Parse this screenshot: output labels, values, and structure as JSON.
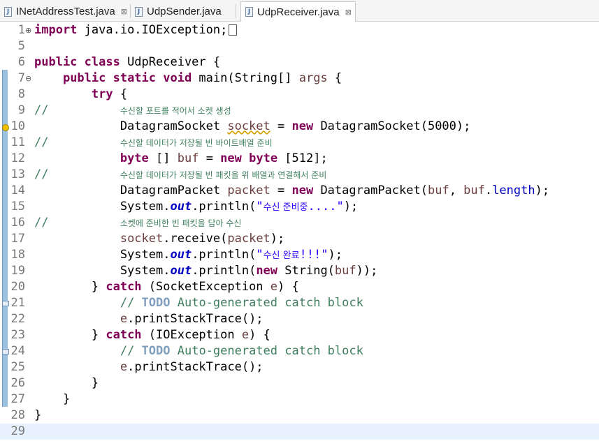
{
  "tabs": [
    {
      "label": "INetAddressTest.java",
      "close": "⊠",
      "icon": "java-file-icon"
    },
    {
      "label": "UdpSender.java",
      "icon": "java-file-icon"
    },
    {
      "label": "UdpReceiver.java",
      "close": "⊠",
      "icon": "java-file-icon"
    }
  ],
  "editor": {
    "lines": [
      {
        "n": "1",
        "marker": "⊕",
        "segs": [
          [
            "kw",
            "import"
          ],
          [
            "",
            "java.io.IOException;"
          ]
        ],
        "fold": true
      },
      {
        "n": "5",
        "segs": []
      },
      {
        "n": "6",
        "segs": [
          [
            "kw",
            "public class"
          ],
          [
            "",
            "UdpReceiver {"
          ]
        ]
      },
      {
        "n": "7",
        "marker": "⊖",
        "segs": [
          [
            "",
            "    "
          ],
          [
            "kw",
            "public static void"
          ],
          [
            "",
            "main(String[]"
          ],
          [
            "var",
            "args"
          ],
          [
            "",
            " {"
          ]
        ]
      },
      {
        "n": "8",
        "segs": [
          [
            "",
            "        "
          ],
          [
            "kw",
            "try"
          ],
          [
            "",
            " {"
          ]
        ]
      },
      {
        "n": "9",
        "segs": [
          [
            "cmt",
            "//          "
          ],
          [
            "kor",
            "수신할 포트를 적어서 소켓 생성"
          ]
        ]
      },
      {
        "n": "10",
        "segs": [
          [
            "",
            "            DatagramSocket "
          ],
          [
            "varw",
            "socket"
          ],
          [
            "",
            " = "
          ],
          [
            "kw",
            "new"
          ],
          [
            "",
            " DatagramSocket(5000);"
          ]
        ]
      },
      {
        "n": "11",
        "segs": [
          [
            "cmt",
            "//          "
          ],
          [
            "kor",
            "수신할 데이터가 저장될 빈 바이트배열 준비"
          ]
        ]
      },
      {
        "n": "12",
        "segs": [
          [
            "",
            "            "
          ],
          [
            "kw",
            "byte"
          ],
          [
            "",
            "[] "
          ],
          [
            "var",
            "buf"
          ],
          [
            "",
            " = "
          ],
          [
            "kw",
            "new byte"
          ],
          [
            "",
            "[512];"
          ]
        ]
      },
      {
        "n": "13",
        "segs": [
          [
            "cmt",
            "//          "
          ],
          [
            "kor",
            "수신할 데이터가 저장될 빈 패킷을 위 배열과 연결해서 준비"
          ]
        ]
      },
      {
        "n": "14",
        "segs": [
          [
            "",
            "            DatagramPacket "
          ],
          [
            "var",
            "packet"
          ],
          [
            "",
            " = "
          ],
          [
            "kw",
            "new"
          ],
          [
            "",
            " DatagramPacket("
          ],
          [
            "var",
            "buf"
          ],
          [
            "",
            ", "
          ],
          [
            "var",
            "buf"
          ],
          [
            "",
            "."
          ],
          [
            "fld",
            "length"
          ],
          [
            "",
            ");"
          ]
        ]
      },
      {
        "n": "15",
        "segs": [
          [
            "",
            "            System."
          ],
          [
            "sfld",
            "out"
          ],
          [
            "",
            ".println("
          ],
          [
            "str",
            "\""
          ],
          [
            "strkor",
            "수신 준비중"
          ],
          [
            "str",
            "....\""
          ],
          [
            "",
            ");"
          ]
        ]
      },
      {
        "n": "16",
        "segs": [
          [
            "cmt",
            "//          "
          ],
          [
            "kor",
            "소켓에 준비한 빈 패킷을 담아 수신"
          ]
        ]
      },
      {
        "n": "17",
        "segs": [
          [
            "",
            "            "
          ],
          [
            "var",
            "socket"
          ],
          [
            "",
            ".receive("
          ],
          [
            "var",
            "packet"
          ],
          [
            "",
            ");"
          ]
        ]
      },
      {
        "n": "18",
        "segs": [
          [
            "",
            "            System."
          ],
          [
            "sfld",
            "out"
          ],
          [
            "",
            ".println("
          ],
          [
            "str",
            "\""
          ],
          [
            "strkor",
            "수신 완료"
          ],
          [
            "str",
            "!!!\""
          ],
          [
            "",
            ");"
          ]
        ]
      },
      {
        "n": "19",
        "segs": [
          [
            "",
            "            System."
          ],
          [
            "sfld",
            "out"
          ],
          [
            "",
            ".println("
          ],
          [
            "kw",
            "new"
          ],
          [
            "",
            " String("
          ],
          [
            "var",
            "buf"
          ],
          [
            "",
            "));"
          ]
        ]
      },
      {
        "n": "20",
        "segs": [
          [
            "",
            "        } "
          ],
          [
            "kw",
            "catch"
          ],
          [
            "",
            " (SocketException "
          ],
          [
            "var",
            "e"
          ],
          [
            "",
            ") {"
          ]
        ]
      },
      {
        "n": "21",
        "segs": [
          [
            "",
            "            "
          ],
          [
            "cmt",
            "// "
          ],
          [
            "todo",
            "TODO"
          ],
          [
            "cmt",
            " Auto-generated catch block"
          ]
        ]
      },
      {
        "n": "22",
        "segs": [
          [
            "",
            "            "
          ],
          [
            "var",
            "e"
          ],
          [
            "",
            ".printStackTrace();"
          ]
        ]
      },
      {
        "n": "23",
        "segs": [
          [
            "",
            "        } "
          ],
          [
            "kw",
            "catch"
          ],
          [
            "",
            " (IOException "
          ],
          [
            "var",
            "e"
          ],
          [
            "",
            ") {"
          ]
        ]
      },
      {
        "n": "24",
        "segs": [
          [
            "",
            "            "
          ],
          [
            "cmt",
            "// "
          ],
          [
            "todo",
            "TODO"
          ],
          [
            "cmt",
            " Auto-generated catch block"
          ]
        ]
      },
      {
        "n": "25",
        "segs": [
          [
            "",
            "            "
          ],
          [
            "var",
            "e"
          ],
          [
            "",
            ".printStackTrace();"
          ]
        ]
      },
      {
        "n": "26",
        "segs": [
          [
            "",
            "        }"
          ]
        ]
      },
      {
        "n": "27",
        "segs": [
          [
            "",
            "    }"
          ]
        ]
      },
      {
        "n": "28",
        "segs": [
          [
            "",
            "}"
          ]
        ]
      },
      {
        "n": "29",
        "segs": [],
        "current": true
      }
    ]
  }
}
